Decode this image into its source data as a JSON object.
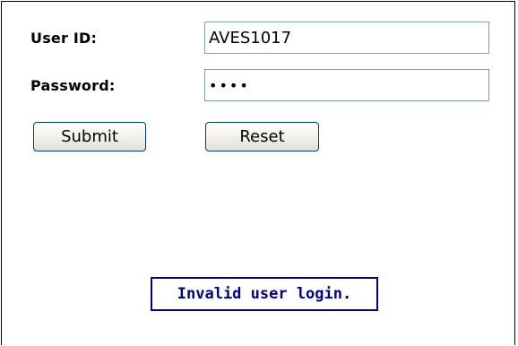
{
  "form": {
    "user_id_label": "User ID:",
    "user_id_value": "AVES1017",
    "password_label": "Password:",
    "password_value": "••••",
    "submit_label": "Submit",
    "reset_label": "Reset"
  },
  "message": {
    "text": "Invalid user login.",
    "color": "#000080"
  }
}
